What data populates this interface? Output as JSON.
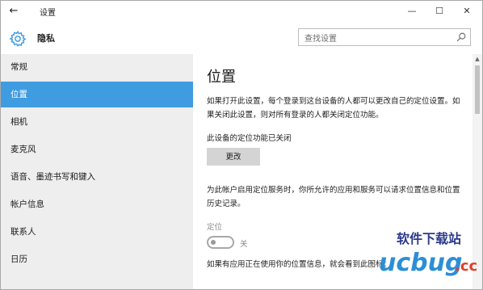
{
  "window": {
    "title": "设置",
    "back_glyph": "←",
    "minimize_glyph": "—",
    "maximize_glyph": "☐",
    "close_glyph": "✕"
  },
  "header": {
    "section_title": "隐私",
    "section_icon": "gear-icon",
    "search_placeholder": "查找设置",
    "search_icon": "search-icon",
    "accent_color": "#3f9ce0"
  },
  "sidebar": {
    "items": [
      {
        "label": "常规",
        "active": false
      },
      {
        "label": "位置",
        "active": true
      },
      {
        "label": "相机",
        "active": false
      },
      {
        "label": "麦克风",
        "active": false
      },
      {
        "label": "语音、墨迹书写和键入",
        "active": false
      },
      {
        "label": "帐户信息",
        "active": false
      },
      {
        "label": "联系人",
        "active": false
      },
      {
        "label": "日历",
        "active": false
      }
    ]
  },
  "main": {
    "title": "位置",
    "description": "如果打开此设置，每个登录到这台设备的人都可以更改自己的定位设置。如果关闭此设置，则对所有登录的人都关闭定位功能。",
    "status": "此设备的定位功能已关闭",
    "change_button": "更改",
    "service_description": "为此帐户启用定位服务时，你所允许的应用和服务可以请求位置信息和位置历史记录。",
    "location_label": "定位",
    "toggle_state": "关",
    "toggle_on": false,
    "footer_text": "如果有应用正在使用你的位置信息，就会看到此图标："
  },
  "scrollbar": {
    "up_glyph": "▲"
  },
  "watermark": {
    "text": "软件下载站 ucbug.cc"
  }
}
